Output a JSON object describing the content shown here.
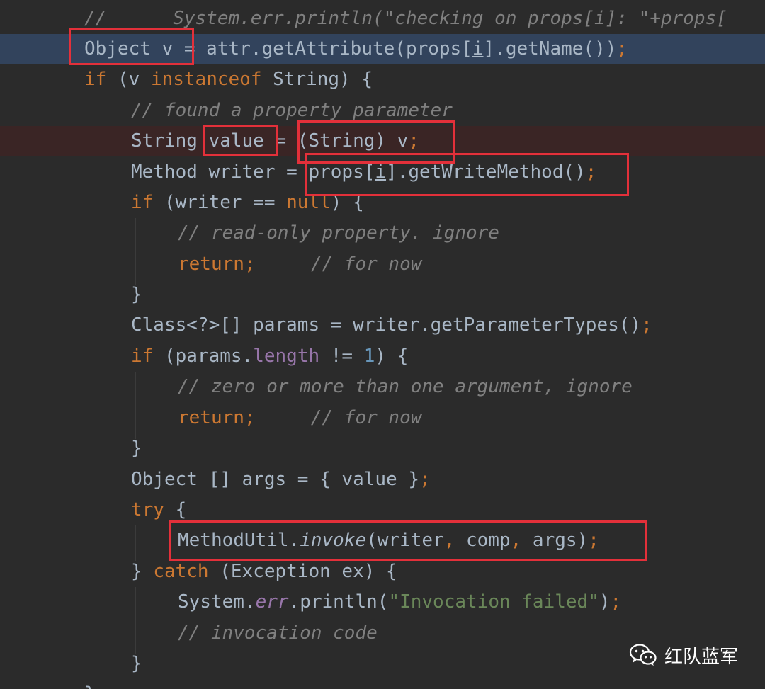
{
  "editor": {
    "language": "java",
    "lines": [
      {
        "text": "//      System.err.println(\"checking on props[i]: \"+props["
      },
      {
        "text": "Object v = attr.getAttribute(props[i].getName());"
      },
      {
        "text": "if (v instanceof String) {"
      },
      {
        "text": "// found a property parameter"
      },
      {
        "text": "String value = (String) v;"
      },
      {
        "text": "Method writer = props[i].getWriteMethod();"
      },
      {
        "text": "if (writer == null) {"
      },
      {
        "text": "// read-only property. ignore"
      },
      {
        "text": "return;     // for now"
      },
      {
        "text": "}"
      },
      {
        "text": "Class<?>[] params = writer.getParameterTypes();"
      },
      {
        "text": "if (params.length != 1) {"
      },
      {
        "text": "// zero or more than one argument, ignore"
      },
      {
        "text": "return;     // for now"
      },
      {
        "text": "}"
      },
      {
        "text": "Object [] args = { value };"
      },
      {
        "text": "try {"
      },
      {
        "text": "MethodUtil.invoke(writer, comp, args);"
      },
      {
        "text": "} catch (Exception ex) {"
      },
      {
        "text": "System.err.println(\"Invocation failed\");"
      },
      {
        "text": "// invocation code"
      },
      {
        "text": "}"
      },
      {
        "text": "}"
      }
    ]
  },
  "watermark": {
    "text": "红队蓝军",
    "icon": "wechat-icon"
  },
  "colors": {
    "background": "#2b2b2b",
    "caret_line": "#32435c",
    "breakpoint_line": "#3a2525",
    "highlight_box": "#e3303a",
    "keyword": "#cc7832",
    "comment": "#808080",
    "string": "#6a8759",
    "number": "#6897bb",
    "field": "#9876aa",
    "text": "#a9b7c6"
  }
}
